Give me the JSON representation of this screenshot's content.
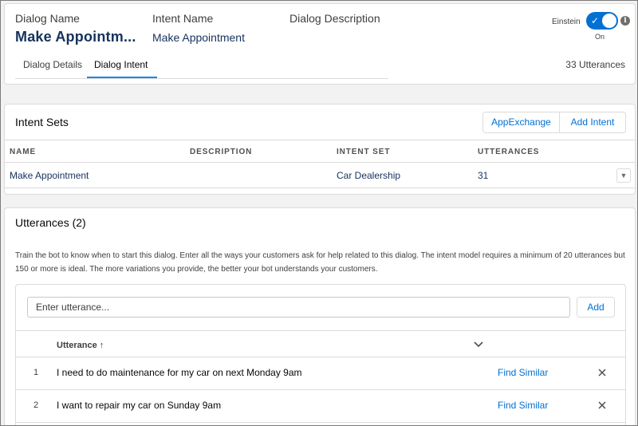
{
  "header": {
    "fields": [
      {
        "label": "Dialog Name",
        "value": "Make Appointm..."
      },
      {
        "label": "Intent Name",
        "value": "Make Appointment"
      },
      {
        "label": "Dialog Description",
        "value": ""
      }
    ],
    "einstein": {
      "label": "Einstein",
      "state": "On",
      "enabled": true,
      "accent": "#0070d2",
      "icon": "check-icon"
    },
    "tabs": [
      {
        "label": "Dialog Details",
        "active": false
      },
      {
        "label": "Dialog Intent",
        "active": true
      }
    ],
    "utterance_count": "33 Utterances"
  },
  "intent_sets": {
    "title": "Intent Sets",
    "buttons": {
      "appexchange": "AppExchange",
      "add_intent": "Add Intent"
    },
    "columns": [
      "NAME",
      "DESCRIPTION",
      "INTENT SET",
      "UTTERANCES"
    ],
    "rows": [
      {
        "name": "Make Appointment",
        "description": "",
        "intent_set": "Car Dealership",
        "utterances": "31"
      }
    ]
  },
  "utterances": {
    "title": "Utterances (2)",
    "description": "Train the bot to know when to start this dialog. Enter all the ways your customers ask for help related to this dialog. The intent model requires a minimum of 20 utterances but 150 or more is ideal. The more variations you provide, the better your bot understands your customers.",
    "input_placeholder": "Enter utterance...",
    "input_value": "",
    "add_label": "Add",
    "column_label": "Utterance",
    "sort_indicator": "↑",
    "rows": [
      {
        "num": "1",
        "text": "I need to do maintenance for my car on next Monday 9am",
        "action": "Find Similar"
      },
      {
        "num": "2",
        "text": "I want to repair my car on Sunday 9am",
        "action": "Find Similar"
      }
    ]
  },
  "colors": {
    "link": "#0070d2",
    "title_blue": "#16325c",
    "active_tab": "#1589ee"
  }
}
